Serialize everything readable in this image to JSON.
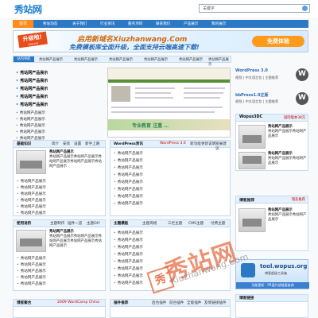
{
  "header": {
    "logo": "秀站网",
    "search_value": "关键字"
  },
  "nav": {
    "items": [
      "首页",
      "秀站动态",
      "关于我们",
      "行业资讯",
      "服务项目",
      "联系我们",
      "产品展示",
      "我的展示"
    ]
  },
  "banner": {
    "tag": "升级啦!",
    "tag_sub": "Upgrade",
    "line1": "启用新域名Xiuzhanwang.Com",
    "line2": "免费模板库全面升级，全面支持云端高速下载!",
    "cta": "免费体验"
  },
  "crumbs": {
    "label": "站内导航",
    "items": [
      "秀站网产品展示",
      "秀站网产品展示",
      "秀站网产品展示",
      "秀站网产品展示",
      "秀站网产品展示",
      "秀站网产品展示"
    ]
  },
  "left_list": {
    "bold": [
      "秀站网产品展示",
      "秀站网产品展示",
      "秀站网产品展示",
      "秀站网产品展示",
      "秀站网产品展示"
    ],
    "normal": [
      "秀站网产品展示",
      "秀站网产品展示",
      "秀站网产品展示",
      "秀站网产品展示",
      "秀站网产品展示",
      "秀站网产品展示"
    ]
  },
  "shot": {
    "band": "专业教育 注重 …"
  },
  "right_top": [
    {
      "title": "WordPress 3.0",
      "sub": "视频 | 中文语言包 | 主题推荐"
    },
    {
      "title": "bbPress1.0正版",
      "sub": "视频 | 中文语言包 | 主题推荐"
    }
  ],
  "wopus_box": {
    "title": "Wopus3DC",
    "tag": "国际版本38元",
    "items": [
      {
        "name": "秀站网产品展示",
        "text": "秀站网产品展示秀站网产品展示"
      },
      {
        "name": "秀站网产品展示",
        "text": "秀站网产品展示秀站网产品展示"
      }
    ]
  },
  "rec_box": {
    "title": "博客推荐",
    "tag": "瑞友推荐",
    "items": [
      {
        "name": "秀站网产品展示",
        "text": "秀站网产品展示秀站网产品展示"
      }
    ]
  },
  "box1": {
    "title": "基础知识",
    "tabs": [
      "简介",
      "安装",
      "设置",
      "新手上路"
    ],
    "feature": {
      "name": "秀站网产品展示",
      "text": "秀站网产品展示秀站网产品展示秀站网产品展示秀站网产品展示秀站网产品展示"
    },
    "items": [
      "秀站网产品展示",
      "秀站网产品展示",
      "秀站网产品展示",
      "秀站网产品展示",
      "秀站网产品展示",
      "秀站网产品展示"
    ]
  },
  "box2": {
    "title": "WordPress资讯",
    "tag": "WordPress 3.0",
    "tabs": [
      "新功能",
      "更新说明",
      "发展建议"
    ],
    "items": [
      "秀站网产品展示",
      "秀站网产品展示",
      "秀站网产品展示",
      "秀站网产品展示",
      "秀站网产品展示",
      "秀站网产品展示",
      "秀站网产品展示",
      "秀站网产品展示"
    ]
  },
  "box3": {
    "title": "使用进阶",
    "tabs": [
      "主题制作",
      "插件一览",
      "主题DIY"
    ],
    "feature": {
      "name": "秀站网产品展示",
      "text": "秀站网产品展示秀站网产品展示秀站网产品展示秀站网产品展示秀站网产品展示"
    },
    "items": [
      "秀站网产品展示",
      "秀站网产品展示",
      "秀站网产品展示",
      "秀站网产品展示",
      "秀站网产品展示",
      "秀站网产品展示",
      "秀站网产品展示"
    ]
  },
  "box4": {
    "title": "主题模板",
    "tabs": [
      "主题风格",
      "三栏主题",
      "CMS主题",
      "付费主题"
    ],
    "items": [
      "秀站网产品展示",
      "秀站网产品展示",
      "秀站网产品展示",
      "秀站网产品展示",
      "秀站网产品展示",
      "秀站网产品展示",
      "秀站网产品展示",
      "秀站网产品展示"
    ]
  },
  "box5": {
    "title": "博客聚合",
    "tag": "2009 WordCamp China"
  },
  "box6": {
    "title": "插件推荐",
    "tabs": [
      "后台插件",
      "前台插件",
      "全能插件",
      "友情链接插件"
    ]
  },
  "box7": {
    "title": "博客链接"
  },
  "ad": {
    "url": "tool.wopus.org",
    "sub": "博客超级工具箱",
    "bar": "功能更新：PR值外部链接查询"
  },
  "watermark": {
    "text": "秀站网",
    "sub": "Xiuzhanwang.Com",
    "stamp": "秀"
  }
}
